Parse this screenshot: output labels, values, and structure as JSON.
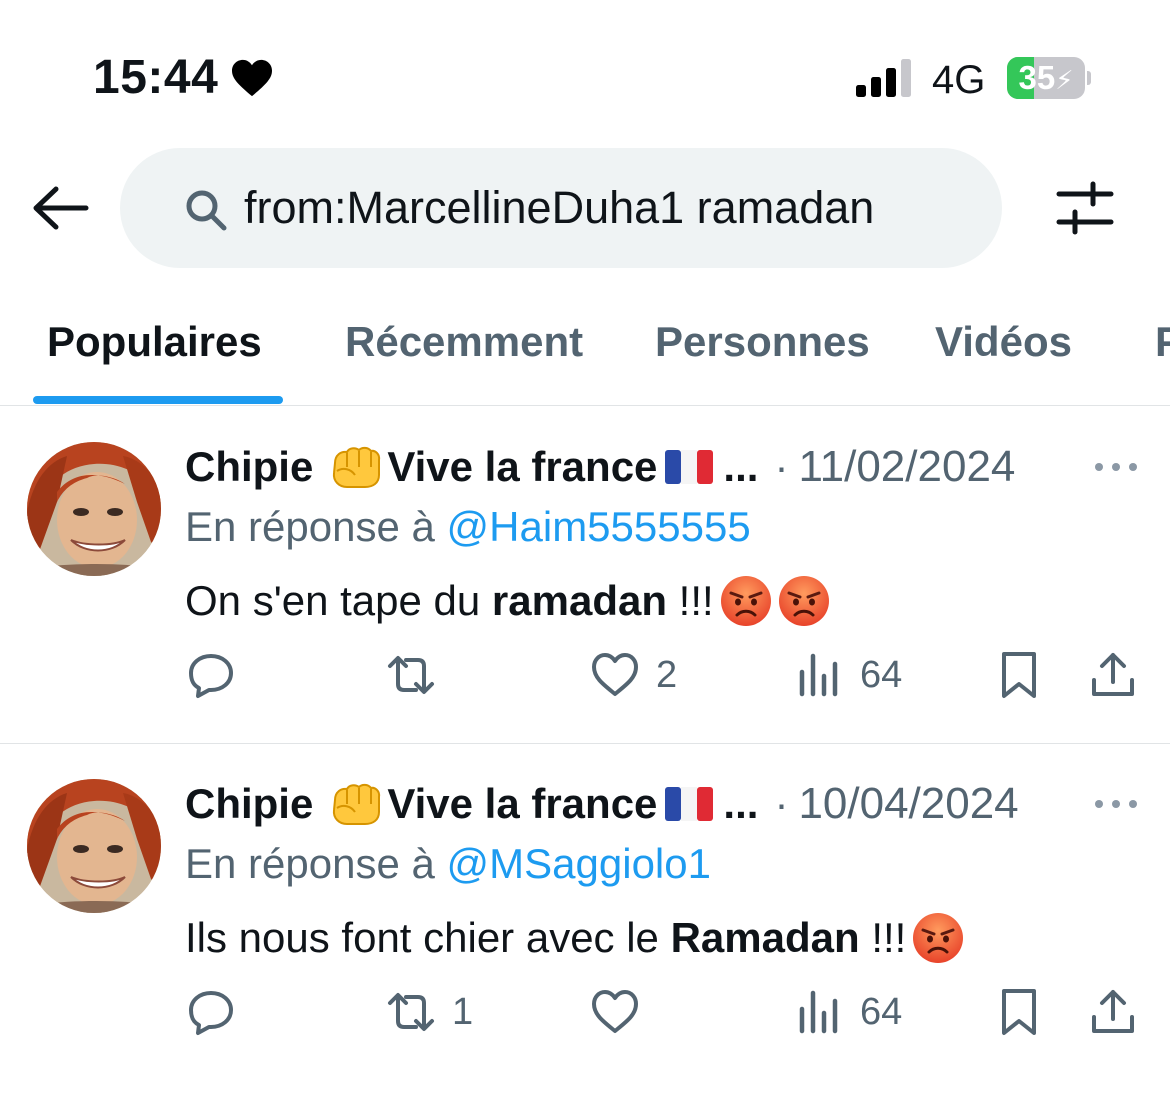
{
  "status_bar": {
    "time": "15:44",
    "network": "4G",
    "battery_text": "35",
    "battery_level": 0.35,
    "battery_color": "#34c759"
  },
  "search": {
    "query": "from:MarcellineDuha1 ramadan",
    "back_icon": "arrow-left-icon",
    "filter_icon": "sliders-icon"
  },
  "tabs": [
    {
      "label": "Populaires",
      "active": true
    },
    {
      "label": "Récemment",
      "active": false
    },
    {
      "label": "Personnes",
      "active": false
    },
    {
      "label": "Vidéos",
      "active": false
    },
    {
      "label": "P",
      "active": false
    }
  ],
  "accent_color": "#1d9bf0",
  "tweets": [
    {
      "author": "Chipie",
      "author_suffix": "Vive la france",
      "truncation": "...",
      "separator": "·",
      "date": "11/02/2024",
      "reply_prefix": "En réponse à",
      "reply_to": "@Haim5555555",
      "text_before": "On s'en tape du",
      "text_bold": "ramadan",
      "text_after": " !!!",
      "angry_emoji_count": 2,
      "replies": "",
      "retweets": "",
      "likes": "2",
      "views": "64"
    },
    {
      "author": "Chipie",
      "author_suffix": "Vive la france",
      "truncation": "...",
      "separator": "·",
      "date": "10/04/2024",
      "reply_prefix": "En réponse à",
      "reply_to": "@MSaggiolo1",
      "text_before": "Ils nous font chier avec le",
      "text_bold": "Ramadan",
      "text_after": " !!!",
      "angry_emoji_count": 1,
      "replies": "",
      "retweets": "1",
      "likes": "",
      "views": "64"
    }
  ]
}
